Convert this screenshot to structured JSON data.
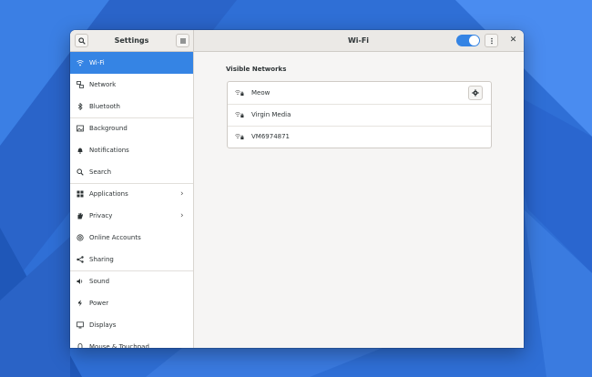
{
  "sidebar": {
    "title": "Settings",
    "items": [
      {
        "label": "Wi-Fi",
        "icon": "wifi-icon",
        "active": true
      },
      {
        "label": "Network",
        "icon": "network-icon"
      },
      {
        "label": "Bluetooth",
        "icon": "bluetooth-icon"
      },
      {
        "label": "Background",
        "icon": "background-icon"
      },
      {
        "label": "Notifications",
        "icon": "bell-icon"
      },
      {
        "label": "Search",
        "icon": "search-icon"
      },
      {
        "label": "Applications",
        "icon": "grid-icon",
        "chevron": true
      },
      {
        "label": "Privacy",
        "icon": "hand-icon",
        "chevron": true
      },
      {
        "label": "Online Accounts",
        "icon": "at-icon"
      },
      {
        "label": "Sharing",
        "icon": "share-icon"
      },
      {
        "label": "Sound",
        "icon": "speaker-icon"
      },
      {
        "label": "Power",
        "icon": "power-icon"
      },
      {
        "label": "Displays",
        "icon": "display-icon"
      },
      {
        "label": "Mouse & Touchpad",
        "icon": "mouse-icon"
      }
    ]
  },
  "header": {
    "title": "Wi-Fi",
    "wifi_enabled": true
  },
  "main": {
    "section_title": "Visible Networks",
    "networks": [
      {
        "name": "Meow",
        "secured": true,
        "connected": true
      },
      {
        "name": "Virgin Media",
        "secured": true
      },
      {
        "name": "VM6974871",
        "secured": true
      }
    ]
  },
  "colors": {
    "accent": "#3584e4",
    "desktop": "#2f6fd6"
  }
}
